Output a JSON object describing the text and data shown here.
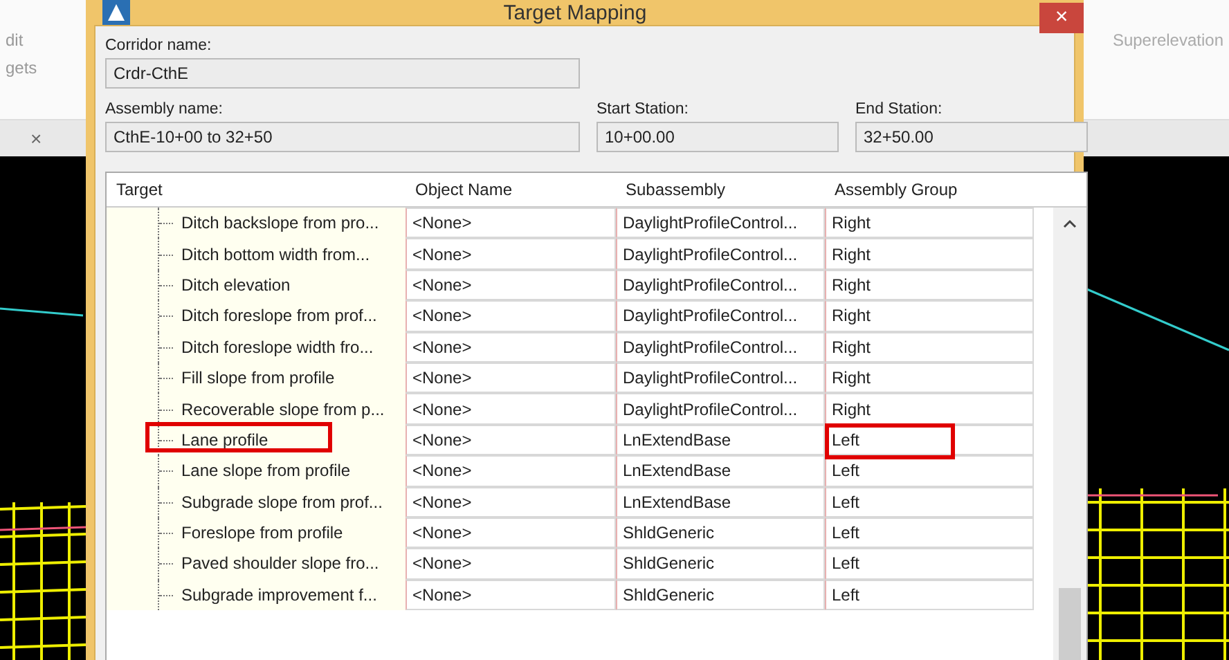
{
  "background": {
    "ribbon_left": [
      "dit",
      "gets"
    ],
    "ribbon_right": "Superelevation",
    "tab_close": "×"
  },
  "window": {
    "title": "Target Mapping",
    "close": "×"
  },
  "fields": [
    {
      "label": "Corridor name:",
      "value": "Crdr-CthE"
    },
    {
      "label": "Assembly name:",
      "value": "CthE-10+00 to 32+50"
    },
    {
      "label": "Start Station:",
      "value": "10+00.00"
    },
    {
      "label": "End Station:",
      "value": "32+50.00"
    }
  ],
  "table": {
    "columns": [
      "Target",
      "Object Name",
      "Subassembly",
      "Assembly Group"
    ],
    "rows": [
      {
        "target": "Ditch backslope from pro...",
        "object_name": "<None>",
        "subassembly": "DaylightProfileControl...",
        "group": "Right",
        "highlighted": false
      },
      {
        "target": "Ditch bottom width from...",
        "object_name": "<None>",
        "subassembly": "DaylightProfileControl...",
        "group": "Right",
        "highlighted": false
      },
      {
        "target": "Ditch elevation",
        "object_name": "<None>",
        "subassembly": "DaylightProfileControl...",
        "group": "Right",
        "highlighted": false
      },
      {
        "target": "Ditch foreslope from prof...",
        "object_name": "<None>",
        "subassembly": "DaylightProfileControl...",
        "group": "Right",
        "highlighted": false
      },
      {
        "target": "Ditch foreslope width fro...",
        "object_name": "<None>",
        "subassembly": "DaylightProfileControl...",
        "group": "Right",
        "highlighted": false
      },
      {
        "target": "Fill slope from profile",
        "object_name": "<None>",
        "subassembly": "DaylightProfileControl...",
        "group": "Right",
        "highlighted": false
      },
      {
        "target": "Recoverable slope from p...",
        "object_name": "<None>",
        "subassembly": "DaylightProfileControl...",
        "group": "Right",
        "highlighted": false
      },
      {
        "target": "Lane profile",
        "object_name": "<None>",
        "subassembly": "LnExtendBase",
        "group": "Left",
        "highlighted": true
      },
      {
        "target": "Lane slope from profile",
        "object_name": "<None>",
        "subassembly": "LnExtendBase",
        "group": "Left",
        "highlighted": false
      },
      {
        "target": "Subgrade slope from prof...",
        "object_name": "<None>",
        "subassembly": "LnExtendBase",
        "group": "Left",
        "highlighted": false
      },
      {
        "target": "Foreslope from profile",
        "object_name": "<None>",
        "subassembly": "ShldGeneric",
        "group": "Left",
        "highlighted": false
      },
      {
        "target": "Paved shoulder slope fro...",
        "object_name": "<None>",
        "subassembly": "ShldGeneric",
        "group": "Left",
        "highlighted": false
      },
      {
        "target": "Subgrade improvement f...",
        "object_name": "<None>",
        "subassembly": "ShldGeneric",
        "group": "Left",
        "highlighted": false
      }
    ]
  }
}
